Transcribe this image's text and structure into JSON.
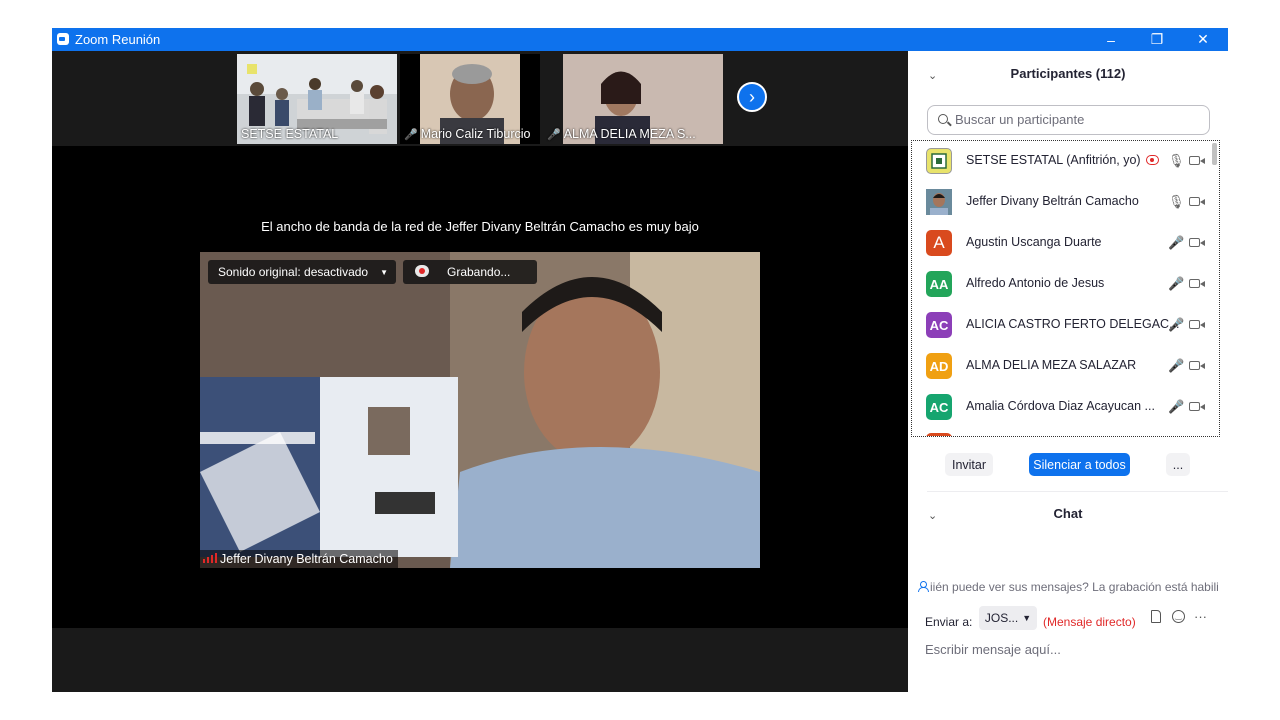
{
  "window": {
    "title": "Zoom Reunión",
    "controls": [
      "–",
      "❐",
      "✕"
    ]
  },
  "thumbnails": [
    {
      "label": "SETSE ESTATAL",
      "muted": false
    },
    {
      "label": "Mario Caliz Tiburcio",
      "muted": true
    },
    {
      "label": "ALMA DELIA MEZA S...",
      "muted": true
    }
  ],
  "bandwidth_notice": "El ancho de banda de la red de Jeffer Divany Beltrán Camacho es muy bajo",
  "main_video": {
    "original_sound": "Sonido original: desactivado",
    "recording": "Grabando...",
    "name": "Jeffer Divany Beltrán Camacho"
  },
  "participants": {
    "header": "Participantes (112)",
    "search_placeholder": "Buscar un participante",
    "list": [
      {
        "name": "SETSE ESTATAL (Anfitrión, yo)",
        "initials": "",
        "color": "#e8e36b",
        "mic": "on"
      },
      {
        "name": "Jeffer Divany Beltrán Camacho",
        "initials": "",
        "color": "#5b7a8c",
        "mic": "on"
      },
      {
        "name": "Agustin Uscanga Duarte",
        "initials": "A",
        "color": "#d94a1e",
        "mic": "off"
      },
      {
        "name": "Alfredo Antonio de Jesus",
        "initials": "AA",
        "color": "#23a55a",
        "mic": "off"
      },
      {
        "name": "ALICIA CASTRO FERTO DELEGAC...",
        "initials": "AC",
        "color": "#8c3fb8",
        "mic": "off"
      },
      {
        "name": "ALMA DELIA MEZA SALAZAR",
        "initials": "AD",
        "color": "#f0a012",
        "mic": "off"
      },
      {
        "name": "Amalia Córdova Diaz Acayucan ...",
        "initials": "AC",
        "color": "#16a56f",
        "mic": "off"
      }
    ],
    "invite": "Invitar",
    "mute_all": "Silenciar a todos",
    "more": "..."
  },
  "chat": {
    "header": "Chat",
    "privacy_notice": "iién puede ver sus mensajes? La grabación está habilit",
    "send_to_label": "Enviar a:",
    "send_to_value": "JOS...",
    "direct_message": "(Mensaje directo)",
    "input_placeholder": "Escribir mensaje aquí..."
  }
}
